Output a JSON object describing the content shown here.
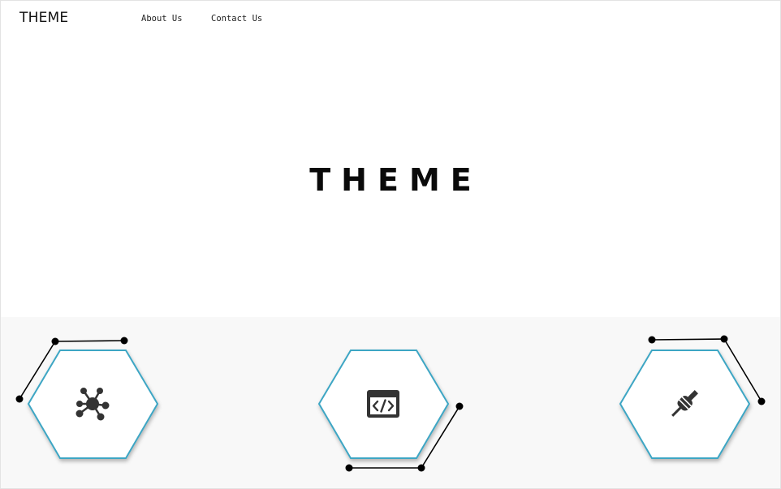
{
  "nav": {
    "brand": "THEME",
    "links": [
      {
        "label": "About Us"
      },
      {
        "label": "Contact Us"
      }
    ]
  },
  "hero": {
    "title": "THEME"
  },
  "features": [
    {
      "icon": "network-nodes-icon"
    },
    {
      "icon": "code-window-icon"
    },
    {
      "icon": "power-plug-icon"
    }
  ],
  "colors": {
    "accent": "#3ea6c4",
    "text": "#111111",
    "icon": "#333333",
    "section_bg": "#f8f8f8"
  }
}
